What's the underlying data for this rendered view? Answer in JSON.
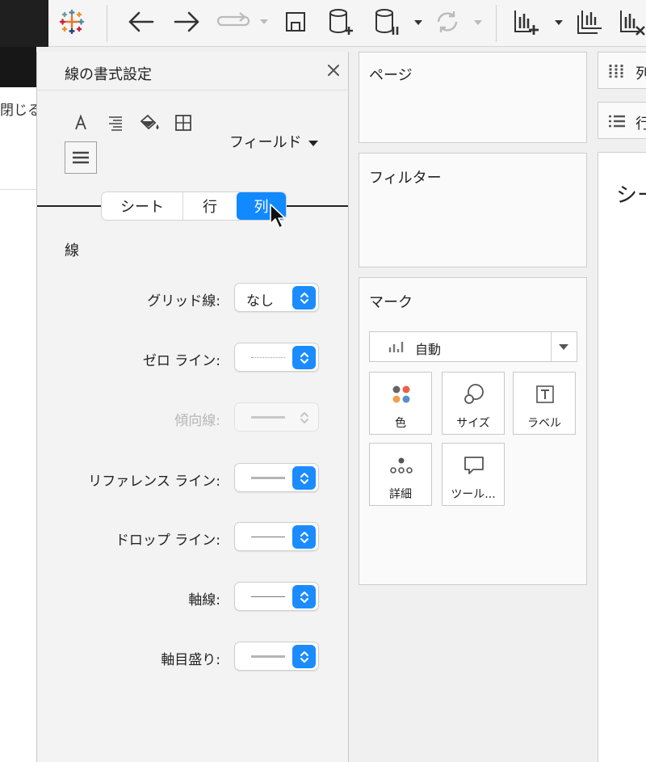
{
  "toolbar": {
    "icons": [
      "tableau-logo-icon",
      "back-arrow-icon",
      "forward-arrow-icon",
      "redo-icon",
      "save-icon",
      "new-datasource-icon",
      "pause-updates-icon",
      "refresh-icon",
      "new-worksheet-icon",
      "duplicate-sheet-icon",
      "clear-sheet-icon"
    ]
  },
  "background": {
    "close_text": "閉じる"
  },
  "format_panel": {
    "title": "線の書式設定",
    "field_dropdown": "フィールド",
    "tabs": [
      {
        "label": "シート",
        "selected": false
      },
      {
        "label": "行",
        "selected": false
      },
      {
        "label": "列",
        "selected": true
      }
    ],
    "section": "線",
    "rows": [
      {
        "label": "グリッド線:",
        "value": "なし",
        "style": "text",
        "enabled": true
      },
      {
        "label": "ゼロ ライン:",
        "value": "",
        "style": "dotted",
        "enabled": true
      },
      {
        "label": "傾向線:",
        "value": "",
        "style": "thick",
        "enabled": false
      },
      {
        "label": "リファレンス ライン:",
        "value": "",
        "style": "thick-gray",
        "enabled": true
      },
      {
        "label": "ドロップ ライン:",
        "value": "",
        "style": "thin",
        "enabled": true
      },
      {
        "label": "軸線:",
        "value": "",
        "style": "thin",
        "enabled": true
      },
      {
        "label": "軸目盛り:",
        "value": "",
        "style": "thick-gray",
        "enabled": true
      }
    ]
  },
  "shelves": {
    "pages": "ページ",
    "filters": "フィルター",
    "marks": {
      "title": "マーク",
      "type": "自動",
      "buttons": [
        "色",
        "サイズ",
        "ラベル",
        "詳細",
        "ツール..."
      ]
    },
    "columns": "列",
    "rows": "行",
    "view_title": "シー"
  },
  "colors": {
    "accent": "#1189ff"
  }
}
